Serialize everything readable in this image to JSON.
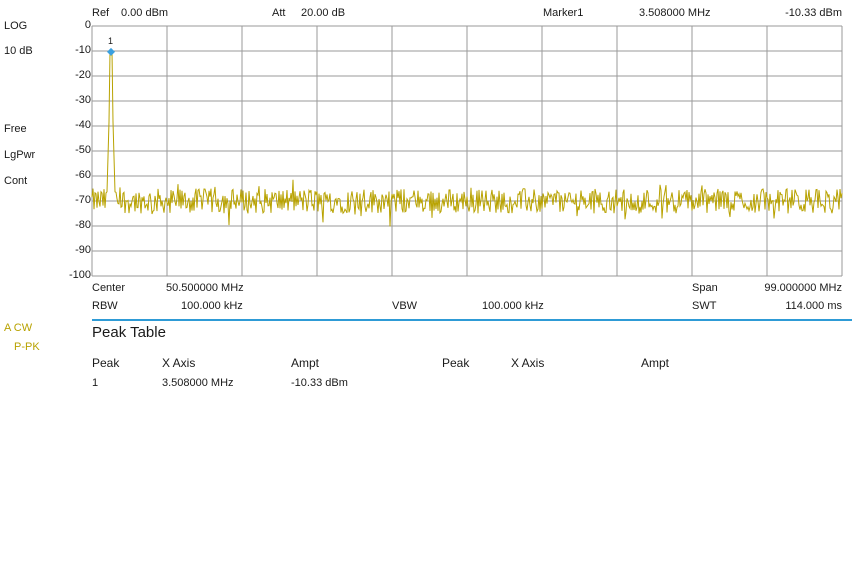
{
  "header": {
    "ref_label": "Ref",
    "ref_value": "0.00 dBm",
    "att_label": "Att",
    "att_value": "20.00 dB",
    "marker_label": "Marker1",
    "marker_freq": "3.508000 MHz",
    "marker_ampt": "-10.33 dBm"
  },
  "left_panel": {
    "scale_type": "LOG",
    "scale_div": "10 dB",
    "trigger": "Free",
    "detector": "LgPwr",
    "sweep_mode": "Cont",
    "trace_name": "A CW",
    "trace_detector": "P-PK"
  },
  "footer": {
    "center_label": "Center",
    "center_value": "50.500000 MHz",
    "span_label": "Span",
    "span_value": "99.000000 MHz",
    "rbw_label": "RBW",
    "rbw_value": "100.000 kHz",
    "vbw_label": "VBW",
    "vbw_value": "100.000 kHz",
    "swt_label": "SWT",
    "swt_value": "114.000 ms"
  },
  "chart_data": {
    "type": "line",
    "y_ticks": [
      "0",
      "-10",
      "-20",
      "-30",
      "-40",
      "-50",
      "-60",
      "-70",
      "-80",
      "-90",
      "-100"
    ],
    "ylim": [
      -100,
      0
    ],
    "xlim_mhz": [
      1.0,
      100.0
    ],
    "grid": true,
    "noise_floor_dbm": -70,
    "noise_variation_db": 5,
    "peak": {
      "x_mhz": 3.508,
      "y_dbm": -10.33,
      "marker_label": "1"
    },
    "trace_color": "#b8a200",
    "marker_color": "#3aa0e0"
  },
  "peak_table": {
    "title": "Peak Table",
    "col_peak": "Peak",
    "col_xaxis": "X Axis",
    "col_ampt": "Ampt",
    "rows": [
      {
        "peak": "1",
        "x": "3.508000 MHz",
        "ampt": "-10.33 dBm"
      }
    ]
  }
}
